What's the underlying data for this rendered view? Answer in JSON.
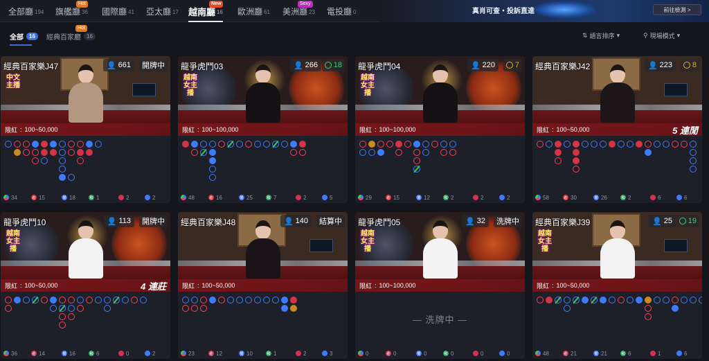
{
  "hall_tabs": [
    {
      "label": "全部廳",
      "count": "194",
      "badge": ""
    },
    {
      "label": "旗艦廳",
      "count": "36",
      "badge": "Hot"
    },
    {
      "label": "國際廳",
      "count": "41",
      "badge": ""
    },
    {
      "label": "亞太廳",
      "count": "17",
      "badge": ""
    },
    {
      "label": "越南廳",
      "count": "16",
      "badge": "New"
    },
    {
      "label": "歐洲廳",
      "count": "61",
      "badge": ""
    },
    {
      "label": "美洲廳",
      "count": "23",
      "badge": "Sexy"
    },
    {
      "label": "電投廳",
      "count": "0",
      "badge": ""
    }
  ],
  "banner": {
    "text": "真肖可查・投訴直達",
    "button": "前往檢測 >"
  },
  "sub_tabs": [
    {
      "label": "全部",
      "count": "16",
      "badge": ""
    },
    {
      "label": "經典百家廳",
      "count": "16",
      "badge": "Hot"
    }
  ],
  "sort": {
    "language": "語言排序",
    "mode": "現場模式"
  },
  "colors": {
    "banker": "#ff3f4f",
    "player": "#3f7bff",
    "tie": "#37c86a",
    "limit_bar": "#76161a",
    "accent": "#3a6fe0"
  },
  "tables": [
    {
      "name": "經典百家樂J47",
      "players": "661",
      "status": "開牌中",
      "timer": "",
      "limit_label": "限紅",
      "limit": "100~50,000",
      "streak": "",
      "zh_badge": "中文主播",
      "shuffling": "",
      "stats": [
        "34",
        "15",
        "18",
        "1",
        "2",
        "2"
      ]
    },
    {
      "name": "龍爭虎鬥03",
      "players": "266",
      "status": "",
      "timer": "18",
      "limit_label": "限紅",
      "limit": "100~100,000",
      "streak": "",
      "zh_badge": "越南女主播",
      "shuffling": "",
      "stats": [
        "48",
        "16",
        "25",
        "7",
        "2",
        "5"
      ]
    },
    {
      "name": "龍爭虎鬥04",
      "players": "220",
      "status": "",
      "timer": "7",
      "limit_label": "限紅",
      "limit": "100~100,000",
      "streak": "",
      "zh_badge": "越南女主播",
      "shuffling": "",
      "stats": [
        "29",
        "15",
        "12",
        "2",
        "2",
        "2"
      ]
    },
    {
      "name": "經典百家樂J42",
      "players": "223",
      "status": "",
      "timer": "8",
      "limit_label": "限紅",
      "limit": "100~50,000",
      "streak": "5 連閒",
      "zh_badge": "",
      "shuffling": "",
      "stats": [
        "58",
        "30",
        "26",
        "2",
        "6",
        "6"
      ]
    },
    {
      "name": "龍爭虎鬥10",
      "players": "113",
      "status": "開牌中",
      "timer": "",
      "limit_label": "限紅",
      "limit": "100~50,000",
      "streak": "4 連莊",
      "zh_badge": "越南女主播",
      "shuffling": "",
      "stats": [
        "36",
        "14",
        "16",
        "6",
        "0",
        "2"
      ]
    },
    {
      "name": "經典百家樂J48",
      "players": "140",
      "status": "結算中",
      "timer": "",
      "limit_label": "限紅",
      "limit": "100~50,000",
      "streak": "",
      "zh_badge": "",
      "shuffling": "",
      "stats": [
        "23",
        "12",
        "10",
        "1",
        "2",
        "3"
      ]
    },
    {
      "name": "龍爭虎鬥05",
      "players": "32",
      "status": "洗牌中",
      "timer": "",
      "limit_label": "限紅",
      "limit": "100~100,000",
      "streak": "",
      "zh_badge": "越南女主播",
      "shuffling": "— 洗牌中 —",
      "stats": [
        "0",
        "0",
        "0",
        "0",
        "0",
        "0"
      ]
    },
    {
      "name": "經典百家樂J39",
      "players": "25",
      "status": "",
      "timer": "19",
      "limit_label": "限紅",
      "limit": "100~50,000",
      "streak": "",
      "zh_badge": "越南女主播",
      "shuffling": "",
      "stats": [
        "48",
        "21",
        "21",
        "6",
        "1",
        "6"
      ]
    }
  ],
  "stat_labels": [
    "局",
    "莊",
    "閒",
    "和",
    "莊對",
    "閒對"
  ]
}
